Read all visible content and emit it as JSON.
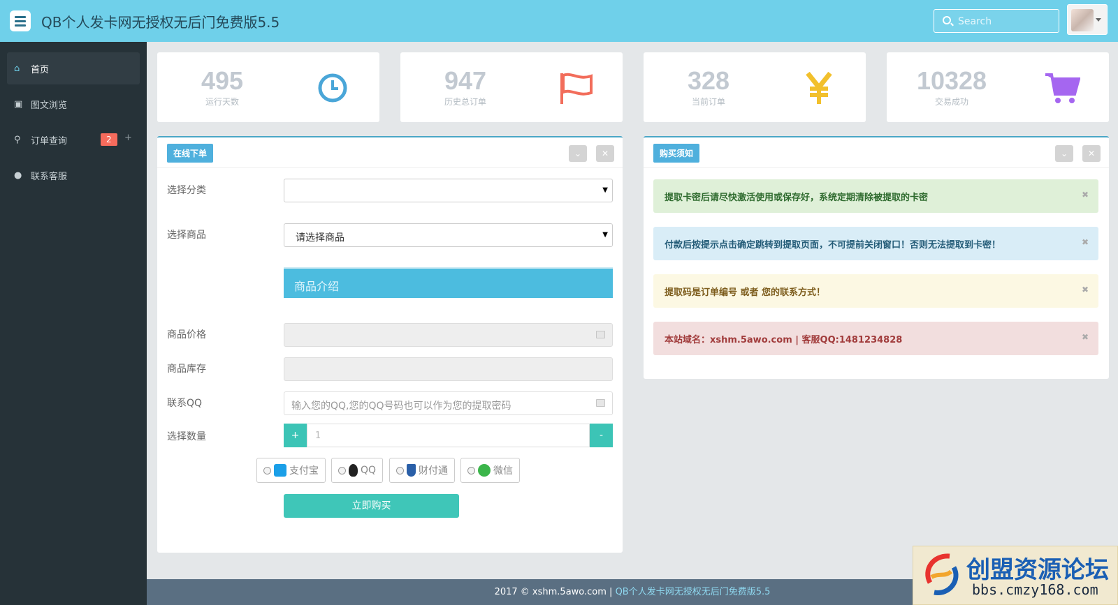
{
  "header": {
    "title": "QB个人发卡网无授权无后门免费版5.5",
    "search_placeholder": "Search"
  },
  "sidebar": {
    "items": [
      {
        "label": "首页",
        "icon": "home-icon"
      },
      {
        "label": "图文浏览",
        "icon": "image-icon"
      },
      {
        "label": "订单查询",
        "icon": "search-icon",
        "badge": "2",
        "extra": "+"
      },
      {
        "label": "联系客服",
        "icon": "user-icon"
      }
    ]
  },
  "stats": [
    {
      "value": "495",
      "label": "运行天数",
      "icon": "clock-icon",
      "color": "#4aa6d8"
    },
    {
      "value": "947",
      "label": "历史总订单",
      "icon": "flag-icon",
      "color": "#f26d5b"
    },
    {
      "value": "328",
      "label": "当前订单",
      "icon": "yen-icon",
      "color": "#f2c02c"
    },
    {
      "value": "10328",
      "label": "交易成功",
      "icon": "cart-icon",
      "color": "#a566f0"
    }
  ],
  "order_panel": {
    "title": "在线下单",
    "collapse_label": "⌄",
    "close_label": "✕",
    "category_label": "选择分类",
    "category_value": "",
    "product_label": "选择商品",
    "product_value": "请选择商品",
    "intro_label": "商品介绍",
    "price_label": "商品价格",
    "stock_label": "商品库存",
    "qq_label": "联系QQ",
    "qq_placeholder": "输入您的QQ,您的QQ号码也可以作为您的提取密码",
    "qty_label": "选择数量",
    "qty_plus": "+",
    "qty_minus": "-",
    "qty_value": "1",
    "pay_methods": [
      {
        "label": "支付宝",
        "icon": "alipay-icon"
      },
      {
        "label": "QQ",
        "icon": "qq-icon"
      },
      {
        "label": "财付通",
        "icon": "tenpay-icon"
      },
      {
        "label": "微信",
        "icon": "wechat-icon"
      }
    ],
    "buy_label": "立即购买"
  },
  "notice_panel": {
    "title": "购买须知",
    "collapse_label": "⌄",
    "close_label": "✕",
    "alerts": [
      {
        "text": "提取卡密后请尽快激活使用或保存好，系统定期清除被提取的卡密",
        "color": "#2f6b2f",
        "bg": "#dff0d8"
      },
      {
        "text": "付款后按提示点击确定跳转到提取页面，不可提前关闭窗口！否则无法提取到卡密！",
        "color": "#245c78",
        "bg": "#d9edf7"
      },
      {
        "text": "提取码是订单编号 或者 您的联系方式！",
        "color": "#7d5d1d",
        "bg": "#fcf8e3"
      },
      {
        "text": "本站域名：xshm.5awo.com | 客服QQ:1481234828",
        "color": "#a13c3c",
        "bg": "#f2dede"
      }
    ],
    "dismiss_label": "✖"
  },
  "footer": {
    "prefix": "2017 © xshm.5awo.com | ",
    "link": "QB个人发卡网无授权无后门免费版5.5"
  },
  "watermark": {
    "title": "创盟资源论坛",
    "url": "bbs.cmzy168.com"
  }
}
